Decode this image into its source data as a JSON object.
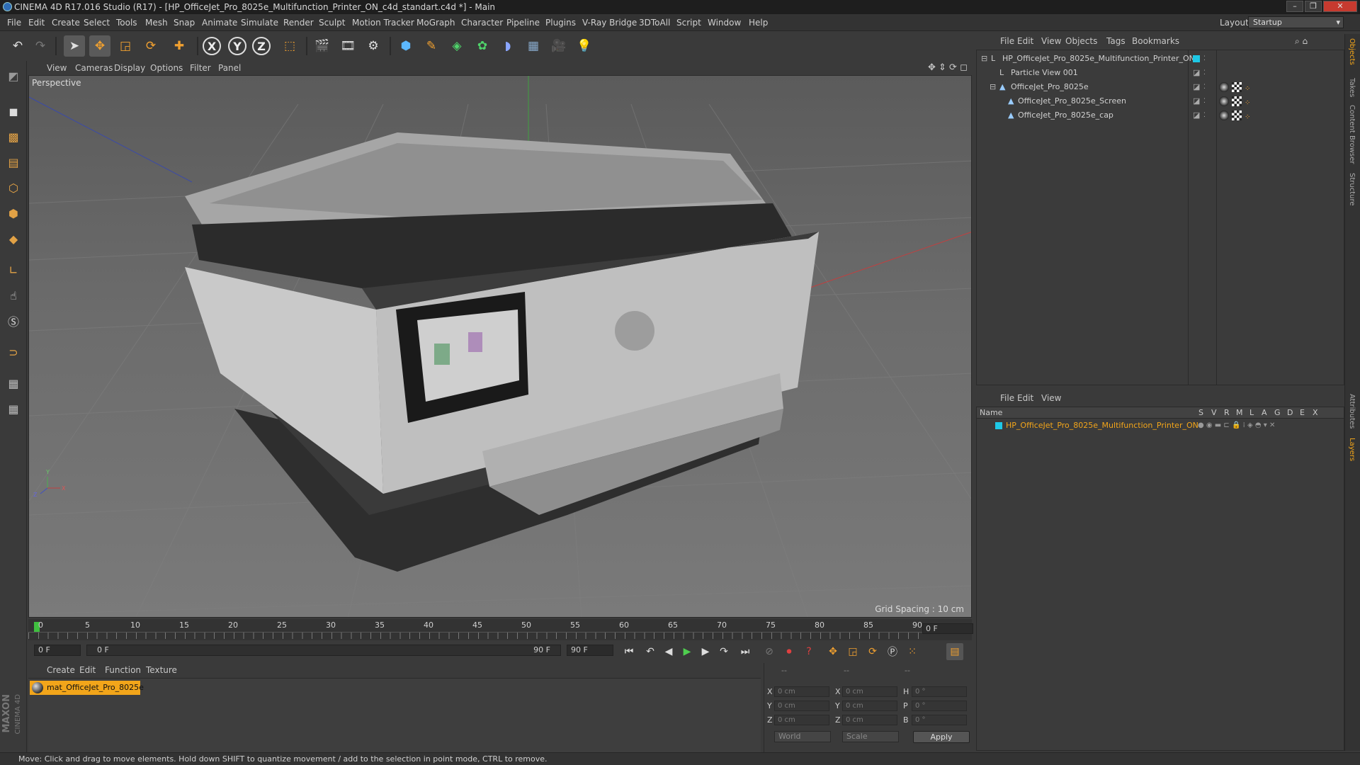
{
  "window": {
    "title": "CINEMA 4D R17.016 Studio (R17) - [HP_OfficeJet_Pro_8025e_Multifunction_Printer_ON_c4d_standart.c4d *] - Main",
    "minimize": "–",
    "maximize": "❐",
    "close": "✕"
  },
  "menubar": {
    "items": [
      "File",
      "Edit",
      "Create",
      "Select",
      "Tools",
      "Mesh",
      "Snap",
      "Animate",
      "Simulate",
      "Render",
      "Sculpt",
      "Motion Tracker",
      "MoGraph",
      "Character",
      "Pipeline",
      "Plugins",
      "V-Ray Bridge",
      "3DToAll",
      "Script",
      "Window",
      "Help"
    ],
    "layout_label": "Layout:",
    "layout_value": "Startup"
  },
  "viewport": {
    "menu": [
      "View",
      "Cameras",
      "Display",
      "Options",
      "Filter",
      "Panel"
    ],
    "label": "Perspective",
    "grid_spacing": "Grid Spacing : 10 cm"
  },
  "timeline": {
    "ticks": [
      "0",
      "5",
      "10",
      "15",
      "20",
      "25",
      "30",
      "35",
      "40",
      "45",
      "50",
      "55",
      "60",
      "65",
      "70",
      "75",
      "80",
      "85",
      "90"
    ],
    "current_frame": "0 F",
    "start_field": "0 F",
    "range_start": "0 F",
    "range_end": "90 F",
    "end_field": "90 F"
  },
  "material_manager": {
    "menu": [
      "Create",
      "Edit",
      "Function",
      "Texture"
    ],
    "material_name": "mat_OfficeJet_Pro_8025e"
  },
  "coordinates": {
    "header": [
      "--",
      "--",
      "--"
    ],
    "rows": [
      {
        "axis": "X",
        "pos": "0 cm",
        "axis2": "X",
        "size": "0 cm",
        "rot_label": "H",
        "rot": "0 °"
      },
      {
        "axis": "Y",
        "pos": "0 cm",
        "axis2": "Y",
        "size": "0 cm",
        "rot_label": "P",
        "rot": "0 °"
      },
      {
        "axis": "Z",
        "pos": "0 cm",
        "axis2": "Z",
        "size": "0 cm",
        "rot_label": "B",
        "rot": "0 °"
      }
    ],
    "mode_world": "World",
    "mode_scale": "Scale",
    "apply": "Apply"
  },
  "object_manager": {
    "menu": [
      "File",
      "Edit",
      "View",
      "Objects",
      "Tags",
      "Bookmarks"
    ],
    "objects": [
      {
        "name": "HP_OfficeJet_Pro_8025e_Multifunction_Printer_ON",
        "indent": 0,
        "type": "null"
      },
      {
        "name": "Particle View 001",
        "indent": 1,
        "type": "null"
      },
      {
        "name": "OfficeJet_Pro_8025e",
        "indent": 1,
        "type": "mesh"
      },
      {
        "name": "OfficeJet_Pro_8025e_Screen",
        "indent": 2,
        "type": "mesh"
      },
      {
        "name": "OfficeJet_Pro_8025e_cap",
        "indent": 2,
        "type": "mesh"
      }
    ]
  },
  "layer_manager": {
    "menu": [
      "File",
      "Edit",
      "View"
    ],
    "columns": [
      "Name",
      "S",
      "V",
      "R",
      "M",
      "L",
      "A",
      "G",
      "D",
      "E",
      "X"
    ],
    "layer_name": "HP_OfficeJet_Pro_8025e_Multifunction_Printer_ON",
    "layer_color": "#1ec8e6"
  },
  "right_tabs": [
    "Objects",
    "Takes",
    "Content Browser",
    "Structure",
    "Attributes",
    "Layers"
  ],
  "status": "Move: Click and drag to move elements. Hold down SHIFT to quantize movement / add to the selection in point mode, CTRL to remove.",
  "logo": {
    "line1": "MAXON",
    "line2": "CINEMA 4D"
  },
  "colors": {
    "accent": "#f2a51a",
    "viewport_bg": "#6a6a6a"
  }
}
